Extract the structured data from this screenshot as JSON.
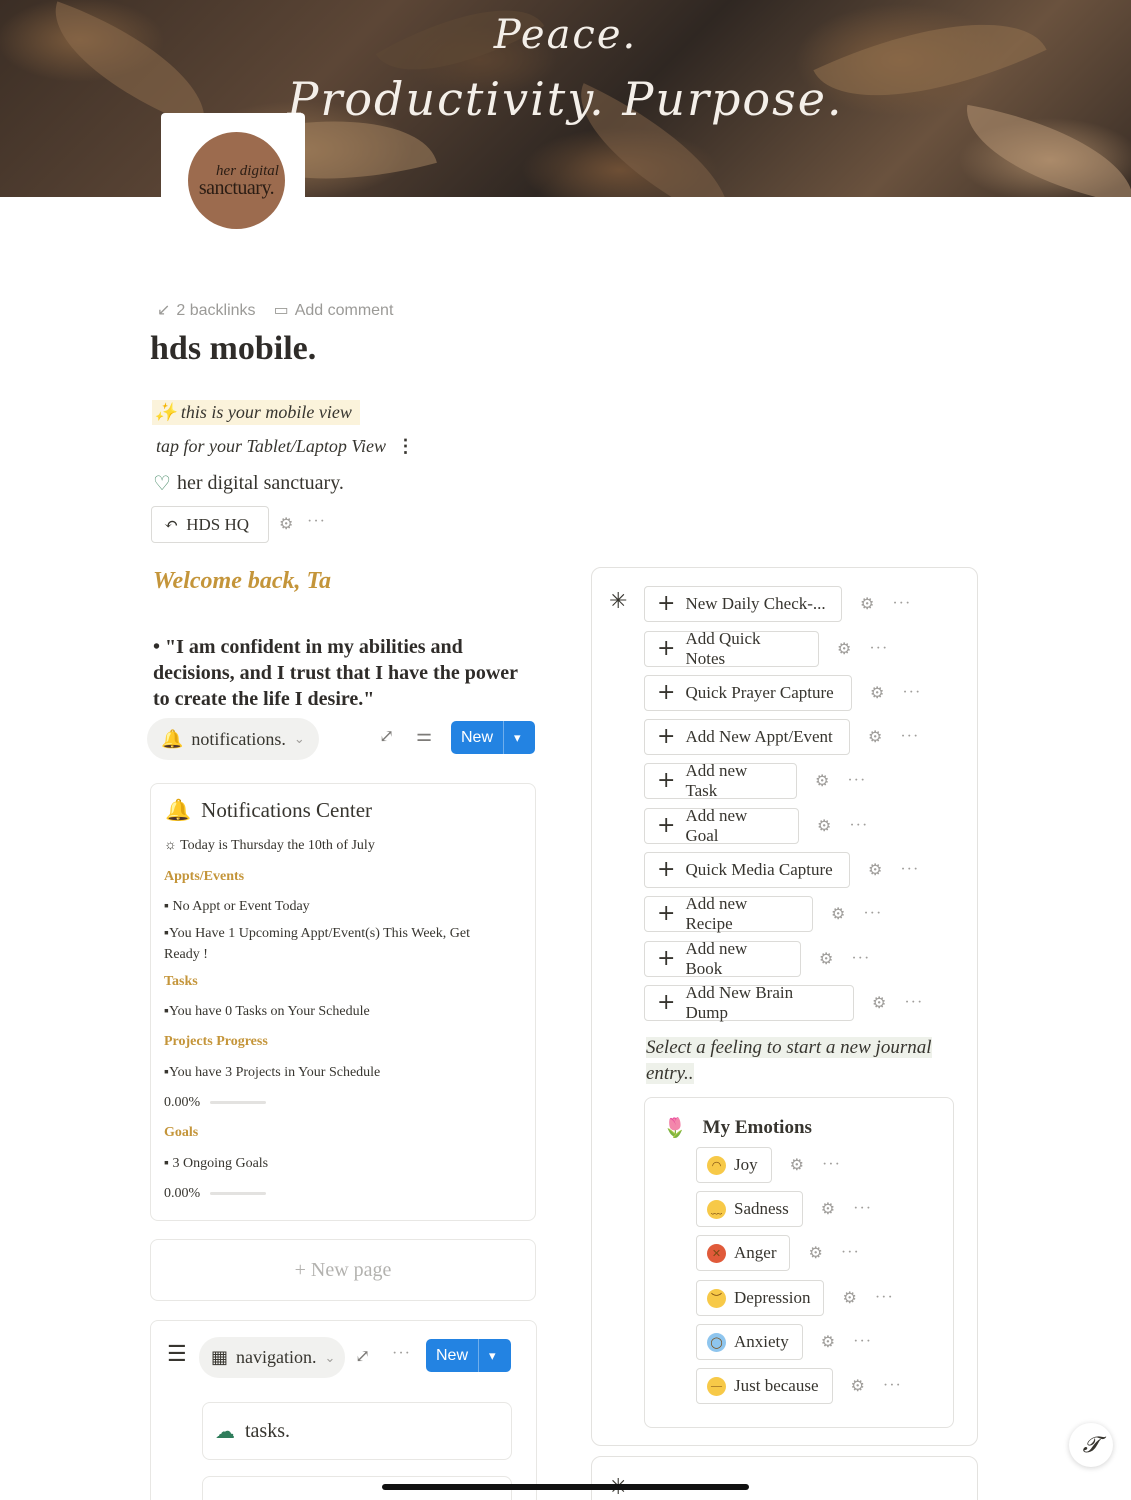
{
  "cover": {
    "line1": "Peace.",
    "line2": "Productivity. Purpose."
  },
  "logo": {
    "line1": "her digital",
    "line2": "sanctuary."
  },
  "meta": {
    "backlinks": "2 backlinks",
    "comment": "Add comment"
  },
  "page_title": "hds mobile.",
  "callouts": {
    "mobile_view": "this is your mobile view",
    "tablet_view": "tap for your Tablet/Laptop View",
    "brand": "her digital sanctuary.",
    "hq_button": "HDS HQ"
  },
  "welcome": "Welcome back, Ta",
  "quote": "• \"I am confident in my abilities and decisions, and I trust that I have the power to create the life I desire.\"",
  "notifications_view": {
    "label": "notifications.",
    "new_label": "New"
  },
  "notifications_center": {
    "title": "Notifications Center",
    "date": "☼ Today is Thursday the 10th of July",
    "appts_header": "Appts/Events",
    "appts_line1": "▪ No Appt or Event Today",
    "appts_line2a": "▪You Have 1 Upcoming Appt/Event(s) This Week, Get",
    "appts_line2b": "Ready !",
    "tasks_header": "Tasks",
    "tasks_line": "▪You have 0 Tasks on Your Schedule",
    "projects_header": "Projects Progress",
    "projects_line": "▪You have 3 Projects in Your Schedule",
    "projects_pct": "0.00%",
    "projects_progress": 0,
    "goals_header": "Goals",
    "goals_line": "▪ 3 Ongoing Goals",
    "goals_pct": "0.00%",
    "goals_progress": 0
  },
  "new_page": "+ New page",
  "navigation_view": {
    "label": "navigation.",
    "new_label": "New",
    "first_item": "tasks."
  },
  "quick_buttons": [
    "New Daily Check-...",
    "Add Quick Notes",
    "Quick Prayer Capture",
    "Add New Appt/Event",
    "Add new Task",
    "Add new Goal",
    "Quick Media Capture",
    "Add new Recipe",
    "Add new Book",
    "Add New Brain Dump"
  ],
  "journal_prompt": "Select a feeling to start a new journal entry..",
  "emotions": {
    "title": "My Emotions",
    "items": [
      "Joy",
      "Sadness",
      "Anger",
      "Depression",
      "Anxiety",
      "Just because"
    ]
  },
  "icons": {
    "gear": "⚙",
    "dots": "···",
    "plus": "+",
    "chevron": "⌄"
  },
  "colors": {
    "accent_gold": "#c4953a",
    "button_blue": "#2383e2",
    "highlight_yellow": "#fbf3db"
  }
}
